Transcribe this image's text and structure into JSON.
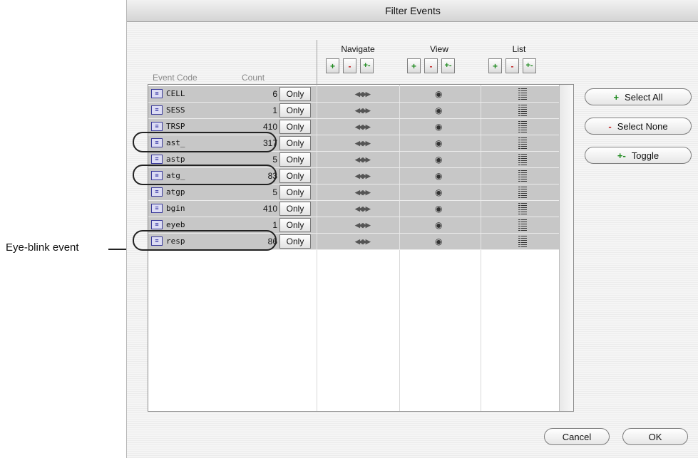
{
  "window": {
    "title": "Filter Events"
  },
  "columns": {
    "event_code": "Event Code",
    "count": "Count",
    "navigate": "Navigate",
    "view": "View",
    "list": "List"
  },
  "toolbar_icons": {
    "plus": "+",
    "minus": "-",
    "toggle": "+-"
  },
  "rows": [
    {
      "code": "CELL",
      "count": "6",
      "only": "Only",
      "highlighted": false
    },
    {
      "code": "SESS",
      "count": "1",
      "only": "Only",
      "highlighted": false
    },
    {
      "code": "TRSP",
      "count": "410",
      "only": "Only",
      "highlighted": false
    },
    {
      "code": "ast_",
      "count": "317",
      "only": "Only",
      "highlighted": true
    },
    {
      "code": "astp",
      "count": "5",
      "only": "Only",
      "highlighted": false
    },
    {
      "code": "atg_",
      "count": "83",
      "only": "Only",
      "highlighted": true
    },
    {
      "code": "atgp",
      "count": "5",
      "only": "Only",
      "highlighted": false
    },
    {
      "code": "bgin",
      "count": "410",
      "only": "Only",
      "highlighted": false
    },
    {
      "code": "eyeb",
      "count": "1",
      "only": "Only",
      "highlighted": false
    },
    {
      "code": "resp",
      "count": "86",
      "only": "Only",
      "highlighted": true
    }
  ],
  "buttons": {
    "select_all": "Select All",
    "select_none": "Select None",
    "toggle": "Toggle",
    "cancel": "Cancel",
    "ok": "OK"
  },
  "annotation": {
    "label": "Eye-blink event"
  },
  "icons": {
    "event": "event-tag-icon",
    "navigate": "navigate-arrows-icon",
    "view": "eye-icon",
    "list": "list-icon"
  },
  "colors": {
    "row_bg": "#c7c7c7",
    "plus": "#1e8a1e",
    "minus": "#c01818"
  }
}
